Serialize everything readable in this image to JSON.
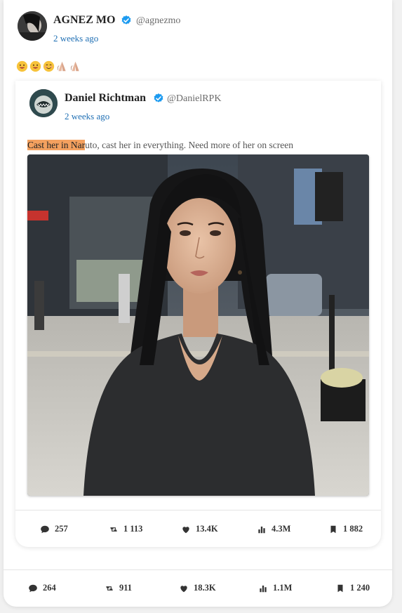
{
  "post": {
    "author_name": "AGNEZ MO",
    "author_handle": "@agnezmo",
    "time": "2 weeks ago",
    "emojis": [
      "grinning-face",
      "grinning-face",
      "smiling-face",
      "folded-hands",
      "folded-hands"
    ],
    "stats": {
      "replies": "264",
      "retweets": "911",
      "likes": "18.3K",
      "views": "1.1M",
      "bookmarks": "1 240"
    }
  },
  "quoted": {
    "author_name": "Daniel Richtman",
    "author_handle": "@DanielRPK",
    "time": "2 weeks ago",
    "text_highlight": "Cast her in Nar",
    "text_rest": "uto, cast her in everything. Need more of her on screen",
    "image_alt": "woman with dark hair in black top on city street",
    "stats": {
      "replies": "257",
      "retweets": "1 113",
      "likes": "13.4K",
      "views": "4.3M",
      "bookmarks": "1 882"
    }
  },
  "colors": {
    "link_blue": "#1f6fb4",
    "verified_blue": "#1d9bf0",
    "highlight": "#f4a15f"
  }
}
